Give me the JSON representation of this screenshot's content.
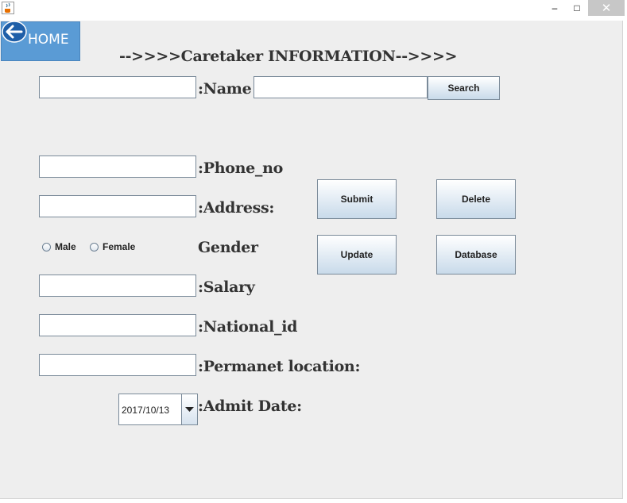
{
  "window": {
    "app_icon": "java-cup-icon",
    "minimize_glyph": "–",
    "maximize_glyph": "□",
    "close_glyph": "✕"
  },
  "home_button": {
    "label": "HOME",
    "icon": "back-arrow-icon"
  },
  "title": "-->>>>Caretaker INFORMATION-->>>>",
  "form": {
    "name_label": ":Name",
    "phone_label": ":Phone_no",
    "address_label": ":Address:",
    "gender_label": "Gender",
    "gender_options": [
      "Male",
      "Female"
    ],
    "salary_label": ":Salary",
    "national_id_label": ":National_id",
    "permanent_location_label": ":Permanet location:",
    "admit_date_label": ":Admit Date:",
    "admit_date_value": "2017/10/13"
  },
  "search_button": "Search",
  "actions": {
    "submit": "Submit",
    "delete": "Delete",
    "update": "Update",
    "database": "Database"
  },
  "colors": {
    "home_bg": "#5a9bd5",
    "button_gradient_bottom": "#c8daea",
    "panel_bg": "#eeeeee"
  }
}
